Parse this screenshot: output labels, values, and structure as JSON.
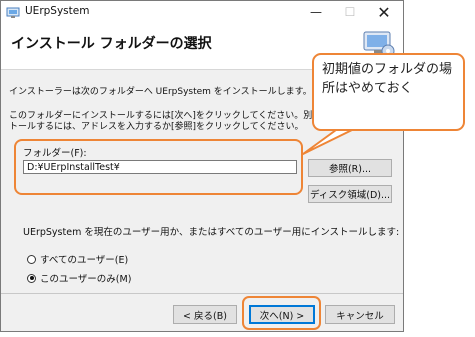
{
  "window": {
    "title": "UErpSystem",
    "minimize_glyph": "—",
    "maximize_glyph": "☐",
    "close_glyph": "✕"
  },
  "header": {
    "title": "インストール フォルダーの選択",
    "icon": "installer-computer-icon"
  },
  "intro": {
    "line1": "インストーラーは次のフォルダーへ UErpSystem をインストールします。",
    "line2": "このフォルダーにインストールするには[次へ]をクリックしてください。別の",
    "line3": "トールするには、アドレスを入力するか[参照]をクリックしてください。"
  },
  "folder": {
    "label": "フォルダー(F):",
    "value": "D:¥UErpInstallTest¥",
    "browse_label": "参照(R)...",
    "disk_cost_label": "ディスク領域(D)..."
  },
  "install_scope": {
    "label": "UErpSystem を現在のユーザー用か、またはすべてのユーザー用にインストールします:",
    "options": [
      {
        "label": "すべてのユーザー(E)",
        "checked": false
      },
      {
        "label": "このユーザーのみ(M)",
        "checked": true
      }
    ]
  },
  "footer": {
    "back_label": "< 戻る(B)",
    "next_label": "次へ(N) >",
    "cancel_label": "キャンセル"
  },
  "annotation": {
    "callout_text": "初期値のフォルダの場所はやめておく",
    "color": "#ee8536"
  }
}
